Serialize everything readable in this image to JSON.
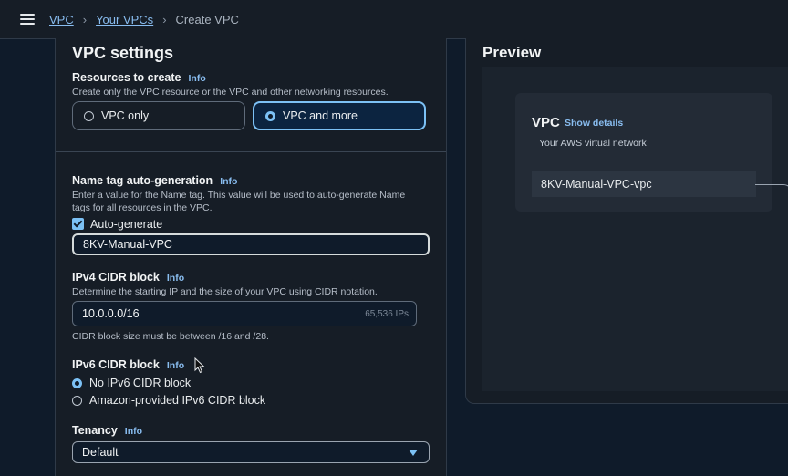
{
  "breadcrumb": {
    "items": [
      "VPC",
      "Your VPCs"
    ],
    "current": "Create VPC"
  },
  "vpc_settings": {
    "title": "VPC settings",
    "resources": {
      "label": "Resources to create",
      "info": "Info",
      "description": "Create only the VPC resource or the VPC and other networking resources.",
      "options": [
        "VPC only",
        "VPC and more"
      ],
      "selected": "VPC and more"
    },
    "name_tag": {
      "label": "Name tag auto-generation",
      "info": "Info",
      "description_line1": "Enter a value for the Name tag. This value will be used to auto-generate Name",
      "description_line2": "tags for all resources in the VPC.",
      "checkbox_label": "Auto-generate",
      "checked": true,
      "value": "8KV-Manual-VPC"
    },
    "ipv4": {
      "label": "IPv4 CIDR block",
      "info": "Info",
      "description": "Determine the starting IP and the size of your VPC using CIDR notation.",
      "value": "10.0.0.0/16",
      "suffix": "65,536 IPs",
      "hint": "CIDR block size must be between /16 and /28."
    },
    "ipv6": {
      "label": "IPv6 CIDR block",
      "info": "Info",
      "options": [
        "No IPv6 CIDR block",
        "Amazon-provided IPv6 CIDR block"
      ],
      "selected": "No IPv6 CIDR block"
    },
    "tenancy": {
      "label": "Tenancy",
      "info": "Info",
      "value": "Default"
    }
  },
  "preview": {
    "title": "Preview",
    "vpc_card": {
      "title": "VPC",
      "show_details": "Show details",
      "subtitle": "Your AWS virtual network",
      "name": "8KV-Manual-VPC-vpc"
    }
  },
  "colors": {
    "accent": "#7cc1f5",
    "link": "#89bdf0",
    "background": "#0f1b2a",
    "panel": "#161d26"
  },
  "icons": [
    "hamburger-icon",
    "chevron-right-icon",
    "checkmark-icon",
    "caret-down-icon",
    "mouse-pointer-icon"
  ]
}
